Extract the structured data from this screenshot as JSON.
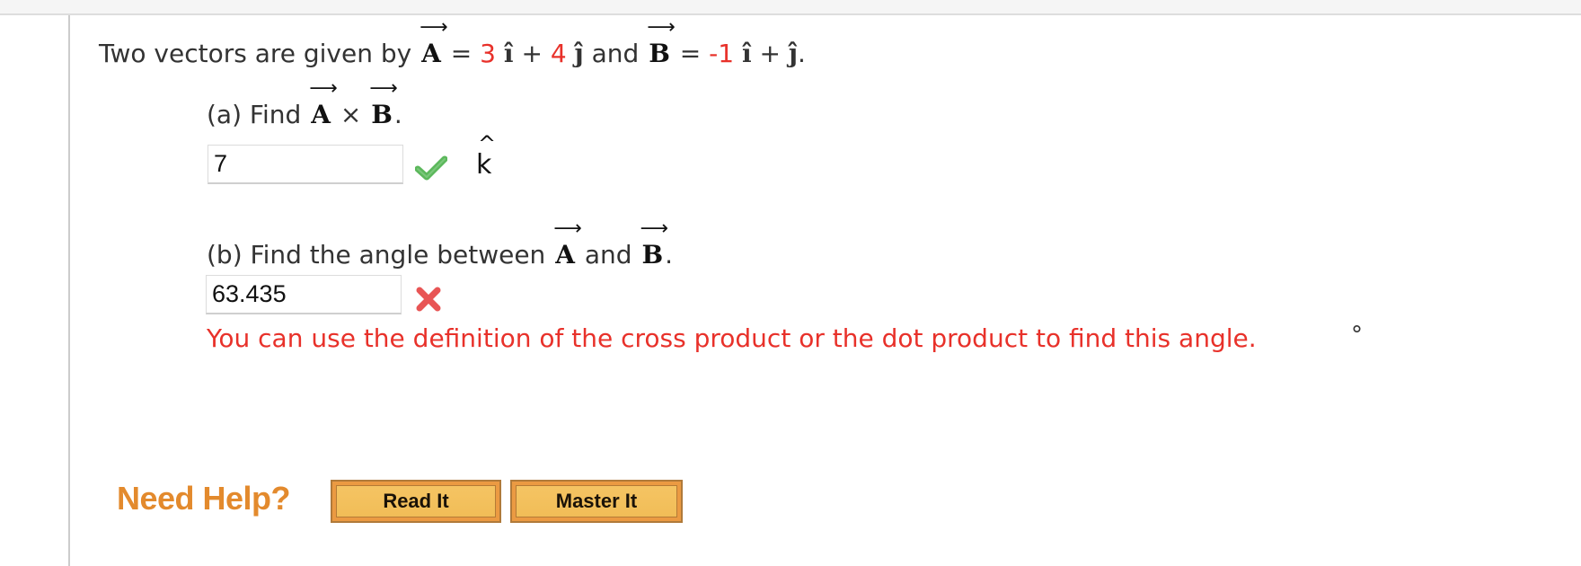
{
  "question": {
    "intro_text": "Two vectors are given by",
    "vector_a": {
      "symbol": "A",
      "arrow": "⟶",
      "equals": "=",
      "i_coef": "3",
      "i_unit": "î",
      "plus": "+",
      "j_coef": "4",
      "j_unit": "ĵ"
    },
    "connector": "and",
    "vector_b": {
      "symbol": "B",
      "arrow": "⟶",
      "equals": "=",
      "i_coef": "-1",
      "i_unit": "î",
      "plus": "+",
      "j_unit": "ĵ"
    },
    "end_punct": "."
  },
  "part_a": {
    "label": "(a) Find",
    "operator": "×",
    "end_punct": ".",
    "answer_value": "7",
    "status": "correct",
    "unit_letter": "k",
    "unit_hat": "^"
  },
  "part_b": {
    "label": "(b) Find the angle between",
    "connector": "and",
    "end_punct": ".",
    "answer_value": "63.435",
    "status": "incorrect",
    "feedback": "You can use the definition of the cross product or the dot product to find this angle.",
    "unit": "°"
  },
  "help": {
    "title": "Need Help?",
    "buttons": [
      {
        "label": "Read It"
      },
      {
        "label": "Master It"
      }
    ]
  },
  "colors": {
    "coefficient_red": "#e8312a",
    "correct_green": "#5cb85c",
    "incorrect_red": "#e85555",
    "help_orange": "#e38a2d"
  }
}
